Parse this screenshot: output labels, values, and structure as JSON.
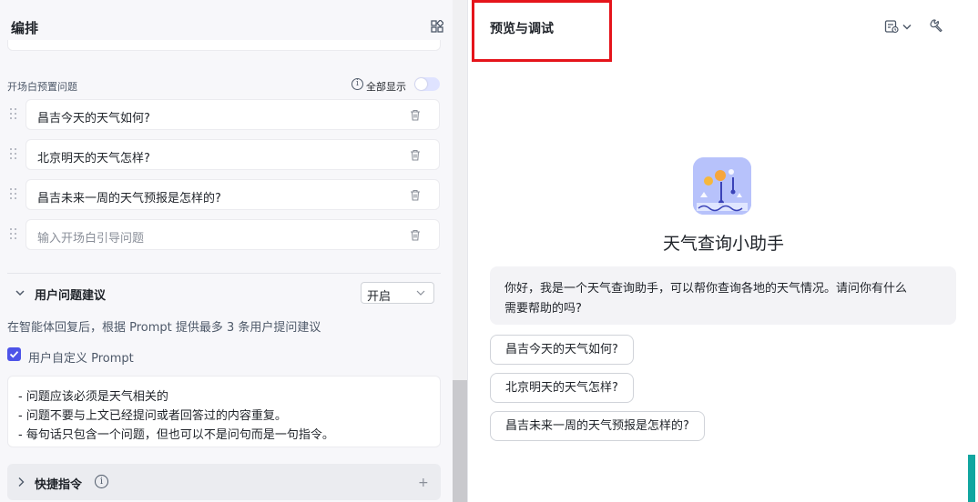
{
  "left_panel": {
    "title": "编排",
    "icons": {
      "layout": "grid-layout-icon"
    },
    "opening_questions": {
      "label": "开场白预置问题",
      "show_all_label": "全部显示",
      "show_all_enabled": false,
      "items": [
        {
          "text": "昌吉今天的天气如何?"
        },
        {
          "text": "北京明天的天气怎样?"
        },
        {
          "text": "昌吉未来一周的天气预报是怎样的?"
        }
      ],
      "new_item_placeholder": "输入开场白引导问题"
    },
    "suggestions": {
      "title": "用户问题建议",
      "mode_value": "开启",
      "description": "在智能体回复后，根据 Prompt 提供最多 3 条用户提问建议",
      "custom_prompt_label": "用户自定义 Prompt",
      "custom_prompt_checked": true,
      "prompt_lines": [
        "- 问题应该必须是天气相关的",
        "- 问题不要与上文已经提问或者回答过的内容重复。",
        "- 每句话只包含一个问题，但也可以不是问句而是一句指令。"
      ]
    },
    "shortcuts": {
      "title": "快捷指令",
      "add_symbol": "+"
    }
  },
  "right_panel": {
    "title": "预览与调试",
    "icons": {
      "history": "history-icon",
      "settings": "wrench-icon"
    },
    "bot": {
      "name": "天气查询小助手",
      "greeting_lines": [
        "你好，我是一个天气查询助手，可以帮你查询各地的天气情况。请问你有什么",
        "需要帮助的吗?"
      ],
      "suggested_questions": [
        {
          "text": "昌吉今天的天气如何?"
        },
        {
          "text": "北京明天的天气怎样?"
        },
        {
          "text": "昌吉未来一周的天气预报是怎样的?"
        }
      ]
    }
  },
  "colors": {
    "accent": "#4d53e8",
    "highlight_border": "#e5141b",
    "panel_bg": "#f7f7fa"
  }
}
